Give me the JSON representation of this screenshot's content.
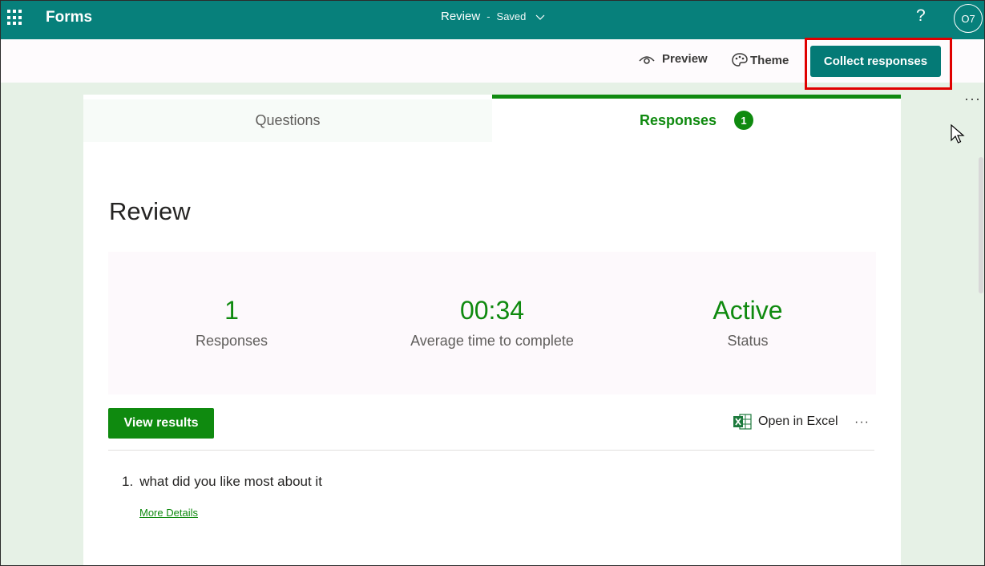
{
  "appbar": {
    "app_name": "Forms",
    "doc_title": "Review",
    "separator": "-",
    "save_status": "Saved",
    "help_label": "?",
    "user_initials": "O7",
    "icons": {
      "launcher": "app-launcher-icon",
      "dropdown": "chevron-down-icon"
    },
    "bg_color": "#07807b"
  },
  "commandbar": {
    "preview_label": "Preview",
    "theme_label": "Theme",
    "collect_label": "Collect responses",
    "more_label": "···"
  },
  "tabs": [
    {
      "label": "Questions",
      "active": false
    },
    {
      "label": "Responses",
      "active": true,
      "badge": "1"
    }
  ],
  "form": {
    "title": "Review",
    "stats": [
      {
        "value": "1",
        "label": "Responses"
      },
      {
        "value": "00:34",
        "label": "Average time to complete"
      },
      {
        "value": "Active",
        "label": "Status"
      }
    ],
    "view_results_label": "View results",
    "open_excel_label": "Open in Excel",
    "more_label": "···",
    "questions": [
      {
        "number": "1.",
        "text": "what did you like most about it",
        "more_details": "More Details"
      }
    ]
  },
  "colors": {
    "accent_green": "#0f8a0f",
    "teal": "#07807b",
    "highlight_red": "#e00000",
    "background": "#e6f1e6"
  }
}
